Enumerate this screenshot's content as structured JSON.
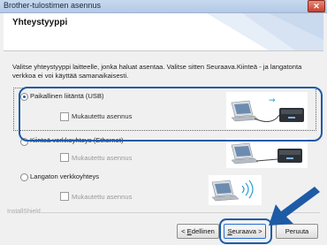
{
  "window": {
    "title": "Brother-tulostimen asennus",
    "close_glyph": "✕"
  },
  "header": {
    "title": "Yhteystyyppi"
  },
  "instruction": "Valitse yhteystyyppi laitteelle, jonka haluat asentaa. Valitse sitten Seuraava.Kiinteä - ja langatonta verkkoa ei voi käyttää samanaikaisesti.",
  "options": [
    {
      "label": "Paikallinen liitäntä (USB)",
      "selected": true,
      "custom_label": "Mukautettu asennus",
      "custom_enabled": true,
      "icon": "usb-connection-icon"
    },
    {
      "label": "Kiinteä verkkoyhteys (Ethernet)",
      "selected": false,
      "custom_label": "Mukautettu asennus",
      "custom_enabled": false,
      "icon": "ethernet-connection-icon"
    },
    {
      "label": "Langaton verkkoyhteys",
      "selected": false,
      "custom_label": "Mukautettu asennus",
      "custom_enabled": false,
      "icon": "wireless-connection-icon"
    }
  ],
  "footer": {
    "installshield": "InstallShield",
    "back_prefix": "< ",
    "back_underlined": "E",
    "back_rest": "dellinen",
    "next_prefix": "",
    "next_underlined": "S",
    "next_rest": "euraava >",
    "cancel": "Peruuta"
  },
  "colors": {
    "highlight": "#1d5ba6",
    "arrow": "#1d5ba6"
  }
}
